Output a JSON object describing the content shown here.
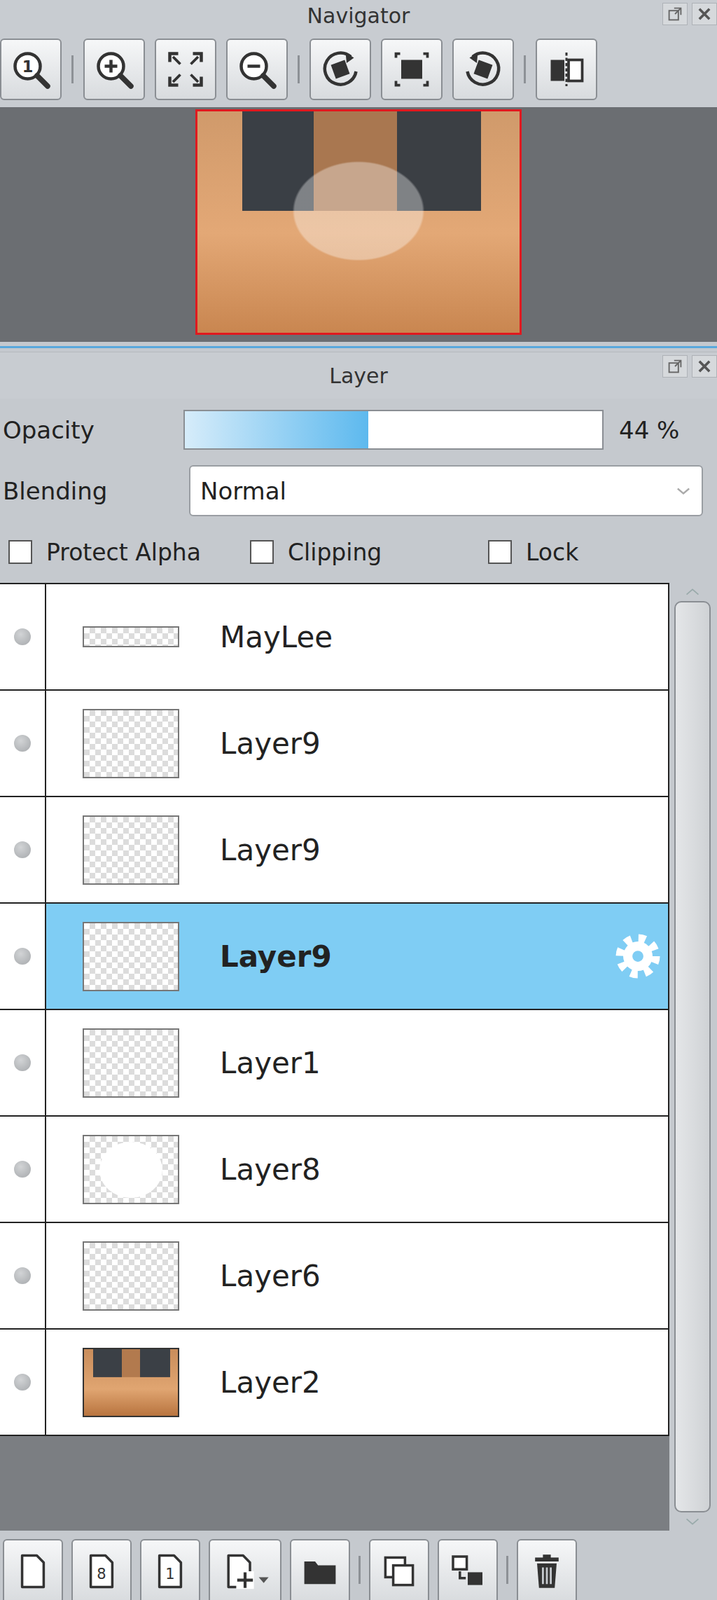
{
  "navigator": {
    "title": "Navigator",
    "window_buttons": [
      {
        "kind": "float"
      },
      {
        "kind": "close"
      }
    ],
    "toolbar": [
      {
        "kind": "zoom-actual",
        "text": "1"
      },
      {
        "kind": "separator"
      },
      {
        "kind": "zoom-in"
      },
      {
        "kind": "zoom-fit"
      },
      {
        "kind": "zoom-out"
      },
      {
        "kind": "separator"
      },
      {
        "kind": "rotate-left"
      },
      {
        "kind": "rotate-reset"
      },
      {
        "kind": "rotate-right"
      },
      {
        "kind": "separator"
      },
      {
        "kind": "flip"
      }
    ]
  },
  "layer_panel": {
    "title": "Layer",
    "window_buttons": [
      {
        "kind": "float"
      },
      {
        "kind": "close"
      }
    ],
    "opacity": {
      "label": "Opacity",
      "level": 0.44,
      "reading": "44 %"
    },
    "blending": {
      "label": "Blending",
      "value": "Normal"
    },
    "options": [
      {
        "label": "Protect Alpha",
        "checked": false
      },
      {
        "label": "Clipping",
        "checked": false
      },
      {
        "label": "Lock",
        "checked": false
      }
    ],
    "layers": [
      {
        "name": "MayLee",
        "thumb": "strip",
        "selected": false
      },
      {
        "name": "Layer9",
        "thumb": "empty",
        "selected": false
      },
      {
        "name": "Layer9",
        "thumb": "empty",
        "selected": false
      },
      {
        "name": "Layer9",
        "thumb": "empty",
        "selected": true
      },
      {
        "name": "Layer1",
        "thumb": "empty",
        "selected": false
      },
      {
        "name": "Layer8",
        "thumb": "circle",
        "selected": false
      },
      {
        "name": "Layer6",
        "thumb": "empty",
        "selected": false
      },
      {
        "name": "Layer2",
        "thumb": "photo",
        "selected": false
      }
    ],
    "toolbar": [
      {
        "kind": "new-layer"
      },
      {
        "kind": "new-8bit",
        "text": "8"
      },
      {
        "kind": "new-1bit",
        "text": "1"
      },
      {
        "kind": "add-layer-menu"
      },
      {
        "kind": "new-folder"
      },
      {
        "kind": "separator"
      },
      {
        "kind": "duplicate"
      },
      {
        "kind": "merge-down"
      },
      {
        "kind": "separator"
      },
      {
        "kind": "delete"
      }
    ]
  }
}
